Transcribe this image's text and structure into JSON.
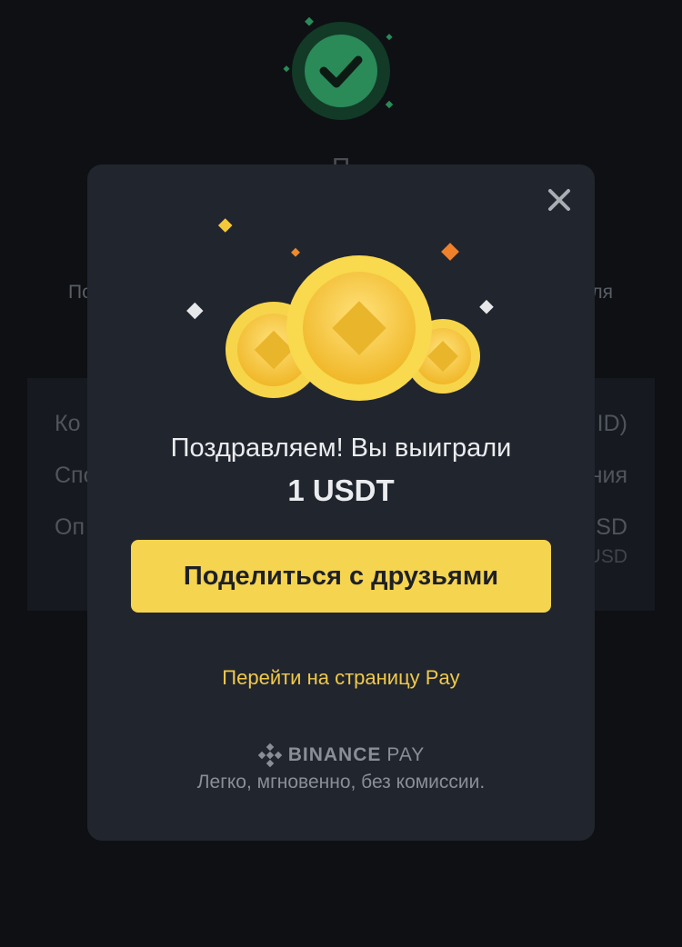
{
  "background": {
    "title_partial": "П",
    "subtitle_left_partial": "По",
    "subtitle_right_partial": "ля",
    "rows": [
      {
        "label_partial": "Ко",
        "value_partial": "ID)"
      },
      {
        "label_partial": "Спо",
        "value_partial": "ния"
      },
      {
        "label_partial": "Оп",
        "value_partial": "SD",
        "sub_value_partial": "USD"
      }
    ]
  },
  "modal": {
    "close_icon": "close-icon",
    "congrats_text": "Поздравляем! Вы выиграли",
    "prize_text": "1 USDT",
    "share_button_label": "Поделиться с друзьями",
    "pay_link_label": "Перейти на страницу Pay",
    "brand_name": "BINANCE",
    "brand_suffix": "PAY",
    "tagline": "Легко, мгновенно, без комиссии."
  },
  "colors": {
    "modal_bg": "#21252d",
    "accent_yellow": "#f5d44f",
    "link_yellow": "#f0c94b",
    "success_green": "#2ea862"
  }
}
